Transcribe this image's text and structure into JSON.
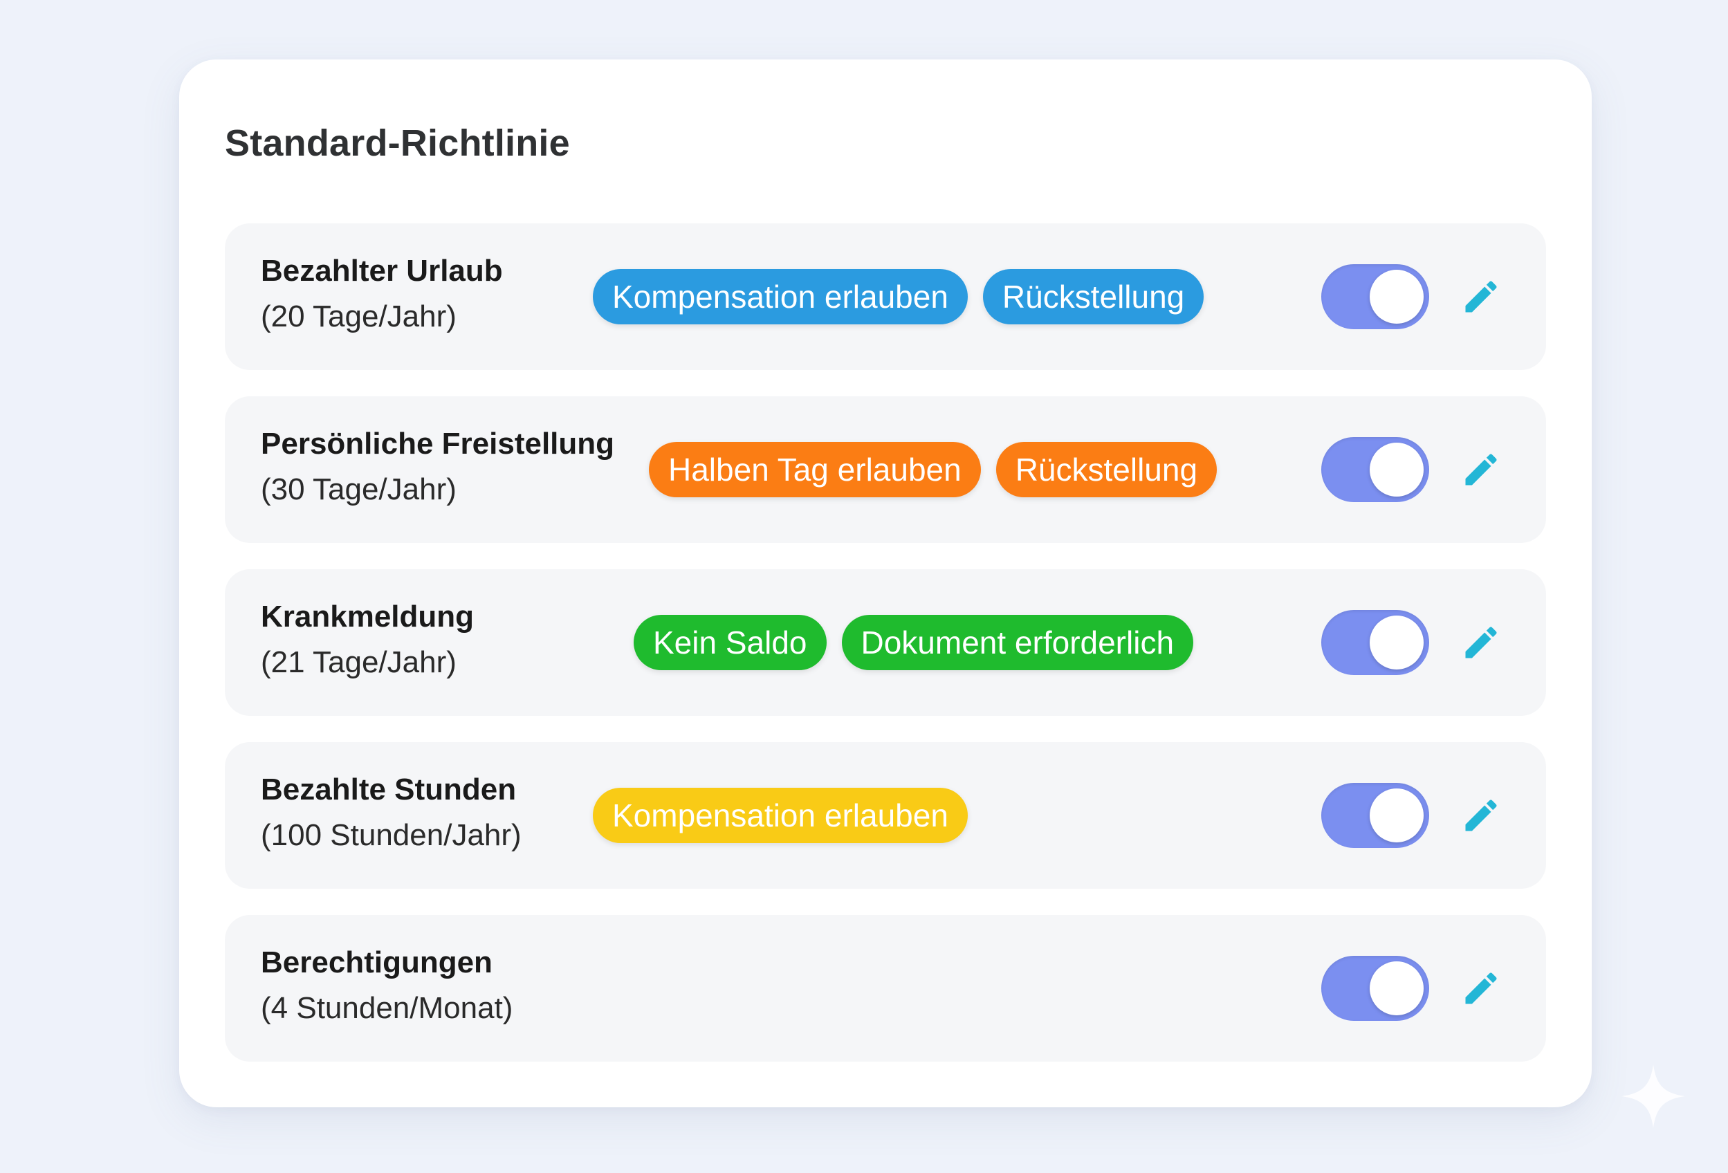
{
  "card": {
    "title": "Standard-Richtlinie"
  },
  "policies": [
    {
      "name": "Bezahlter Urlaub",
      "allowance": "(20 Tage/Jahr)",
      "tag_color": "#2b9be0",
      "tags": [
        "Kompensation erlauben",
        "Rückstellung"
      ],
      "enabled": true
    },
    {
      "name": "Persönliche Freistellung",
      "allowance": "(30 Tage/Jahr)",
      "tag_color": "#fb7d14",
      "tags": [
        "Halben Tag erlauben",
        "Rückstellung"
      ],
      "enabled": true
    },
    {
      "name": "Krankmeldung",
      "allowance": "(21 Tage/Jahr)",
      "tag_color": "#1fbb2e",
      "tags": [
        "Kein Saldo",
        "Dokument erforderlich"
      ],
      "enabled": true
    },
    {
      "name": "Bezahlte Stunden",
      "allowance": "(100 Stunden/Jahr)",
      "tag_color": "#f9cb16",
      "tags": [
        "Kompensation erlauben"
      ],
      "enabled": true
    },
    {
      "name": "Berechtigungen",
      "allowance": "(4 Stunden/Monat)",
      "tag_color": "",
      "tags": [],
      "enabled": true
    }
  ],
  "colors": {
    "toggle_on": "#7b8ff0",
    "edit_icon": "#23b6d6"
  },
  "icons": {
    "edit": "pencil-icon",
    "decoration": "sparkle-icon"
  }
}
